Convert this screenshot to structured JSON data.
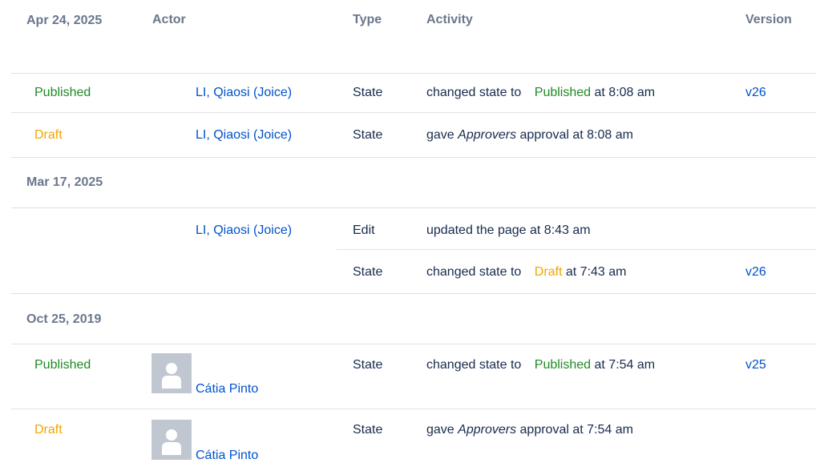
{
  "header": {
    "date": "Apr 24, 2025",
    "actor": "Actor",
    "type": "Type",
    "activity": "Activity",
    "version": "Version"
  },
  "groups": [
    "Mar 17, 2025",
    "Oct 25, 2019"
  ],
  "rows": [
    {
      "state": "Published",
      "actor": "LI, Qiaosi (Joice)",
      "type": "State",
      "pre": "changed state to",
      "status": "Published",
      "post": "at 8:08 am",
      "version": "v26"
    },
    {
      "state": "Draft",
      "actor": "LI, Qiaosi (Joice)",
      "type": "State",
      "pre": "gave",
      "italic": "Approvers",
      "post": "approval at 8:08 am"
    },
    {
      "actor": "LI, Qiaosi (Joice)",
      "type": "Edit",
      "text": "updated the page at 8:43 am"
    },
    {
      "type": "State",
      "pre": "changed state to",
      "status": "Draft",
      "post": "at 7:43 am",
      "version": "v26"
    },
    {
      "state": "Published",
      "actor": "Cátia Pinto",
      "type": "State",
      "pre": "changed state to",
      "status": "Published",
      "post": "at 7:54 am",
      "version": "v25"
    },
    {
      "state": "Draft",
      "actor": "Cátia Pinto",
      "type": "State",
      "pre": "gave",
      "italic": "Approvers",
      "post": "approval at 7:54 am"
    }
  ],
  "icons": {
    "avatar": "default-avatar-icon"
  },
  "colors": {
    "published": "#1f8b24",
    "draft": "#f2a500",
    "link": "#0052cc",
    "header": "#6b778c",
    "divider": "#dfe1e6"
  }
}
